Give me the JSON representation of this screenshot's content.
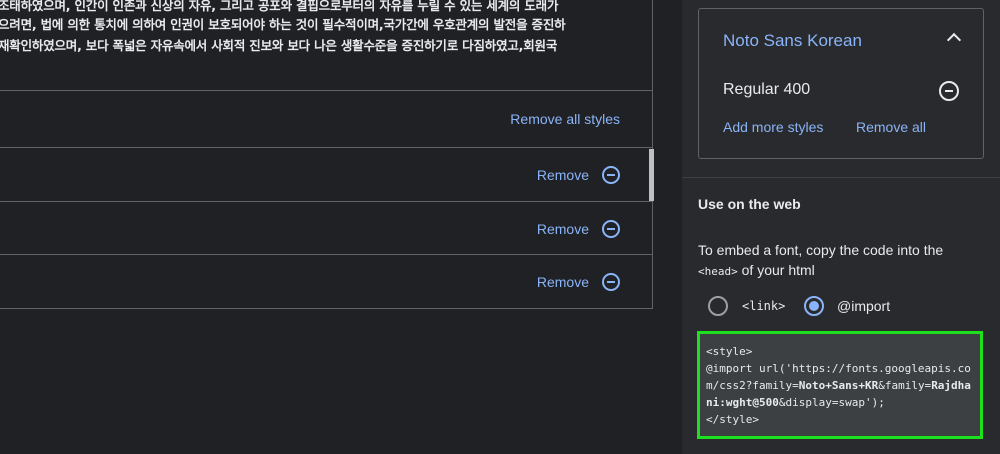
{
  "specimen": {
    "lines": [
      "조태하였으며, 인간이 인존과 신상의 자유, 그리고 공포와 결핍으로부터의 자유를 누릴 수 있는 세계의 도래가",
      "으려면, 법에 의한 통치에 의하여 인권이 보호되어야 하는 것이 필수적이며,국가간에 우호관계의 발전을 증진하",
      "재확인하였으며, 보다 폭넓은 자유속에서 사회적 진보와 보다 나은 생활수준을 증진하기로 다짐하였고,회원국"
    ]
  },
  "styles_list": {
    "remove_all_label": "Remove all styles",
    "rows": [
      {
        "remove_label": "Remove"
      },
      {
        "remove_label": "Remove"
      },
      {
        "remove_label": "Remove"
      }
    ]
  },
  "family_card": {
    "name": "Noto Sans Korean",
    "style": "Regular 400",
    "add_more_label": "Add more styles",
    "remove_all_label": "Remove all"
  },
  "web": {
    "heading": "Use on the web",
    "embed_text_1": "To embed a font, copy the code into the",
    "embed_code_tag": "<head>",
    "embed_text_2": " of your html",
    "radio_link_label": "<link>",
    "radio_import_label": "@import",
    "selected": "@import",
    "code": {
      "line1": "<style>",
      "part1": "@import url('https://fonts.googleapis.com/css2?family=",
      "bold1": "Noto+Sans+KR",
      "part2": "&family=",
      "bold2": "Rajdhani:wght@500",
      "part3": "&display=swap');",
      "line_end": "</style>"
    }
  },
  "colors": {
    "background": "#202124",
    "panel": "#292a2d",
    "accent": "#8ab4f8",
    "highlight_outline": "#1fe01f"
  }
}
